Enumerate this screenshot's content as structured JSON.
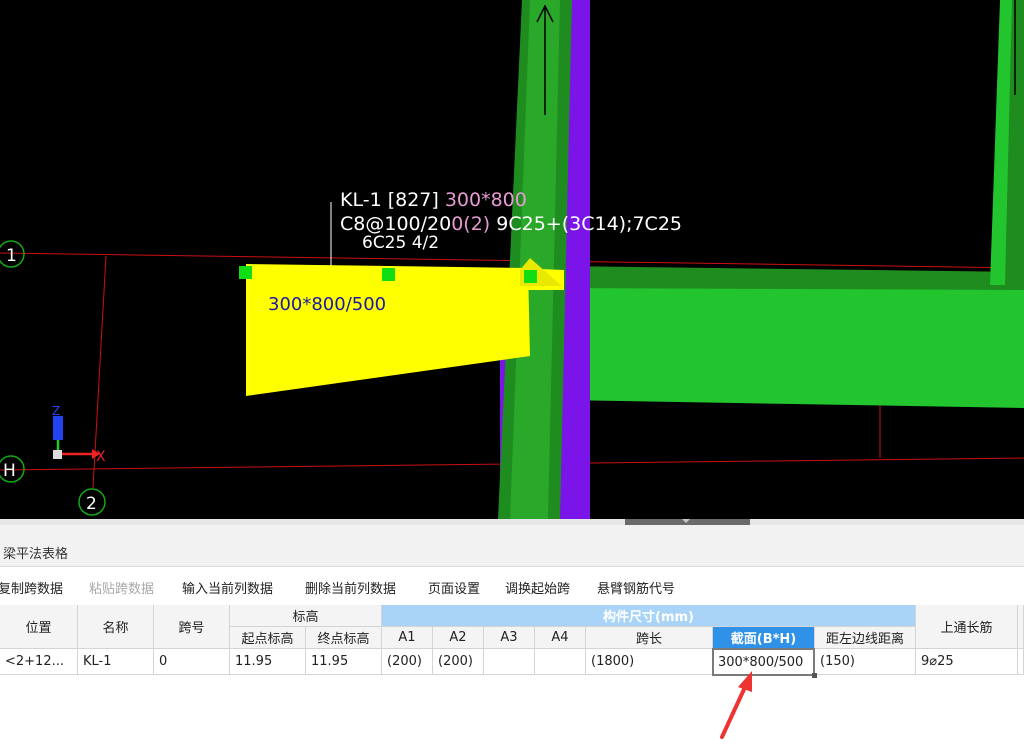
{
  "canvas": {
    "colors": {
      "background": "#000000",
      "grid_line": "#cc1010",
      "beam_selected": "#ffff00",
      "beam": "#22c52e",
      "column_dark": "#1f8c1f",
      "purple_member": "#7a14e8",
      "grip": "#11dd11",
      "label_white": "#ffffff",
      "label_pink": "#e69ad2",
      "label_blue": "#1a1aa6"
    },
    "axis_labels": {
      "axis_1": "1",
      "axis_h": "H",
      "axis_2": "2"
    },
    "beam_annotation": {
      "line1_a": "KL-1 [827] ",
      "line1_b": "300*800",
      "line2_a": "C8@100/20",
      "line2_b": "0(2)",
      "line2_c": " 9C25+(3C14);7C25",
      "line3": "6C25 4/2"
    },
    "section_label": "300*800/500",
    "ucs": {
      "x_label": "X",
      "z_label": "Z"
    }
  },
  "panel": {
    "title": "梁平法表格",
    "toolbar": [
      {
        "label": "复制跨数据",
        "enabled": true
      },
      {
        "label": "粘贴跨数据",
        "enabled": false
      },
      {
        "label": "输入当前列数据",
        "enabled": true
      },
      {
        "label": "删除当前列数据",
        "enabled": true
      },
      {
        "label": "页面设置",
        "enabled": true
      },
      {
        "label": "调换起始跨",
        "enabled": true
      },
      {
        "label": "悬臂钢筋代号",
        "enabled": true
      }
    ],
    "headers": {
      "position": "位置",
      "name": "名称",
      "span_no": "跨号",
      "elevation": "标高",
      "start_elev": "起点标高",
      "end_elev": "终点标高",
      "dims": "构件尺寸(mm)",
      "a1": "A1",
      "a2": "A2",
      "a3": "A3",
      "a4": "A4",
      "span_len": "跨长",
      "section": "截面(B*H)",
      "left_dist": "距左边线距离",
      "top_bar": "上通长筋"
    },
    "row": {
      "position": "<2+12...",
      "name": "KL-1",
      "span_no": "0",
      "start_elev": "11.95",
      "end_elev": "11.95",
      "a1": "(200)",
      "a2": "(200)",
      "a3": "",
      "a4": "",
      "span_len": "(1800)",
      "section": "300*800/500",
      "left_dist": "(150)",
      "top_bar": "9⌀25"
    }
  },
  "annotation_arrow_color": "#ee3333"
}
